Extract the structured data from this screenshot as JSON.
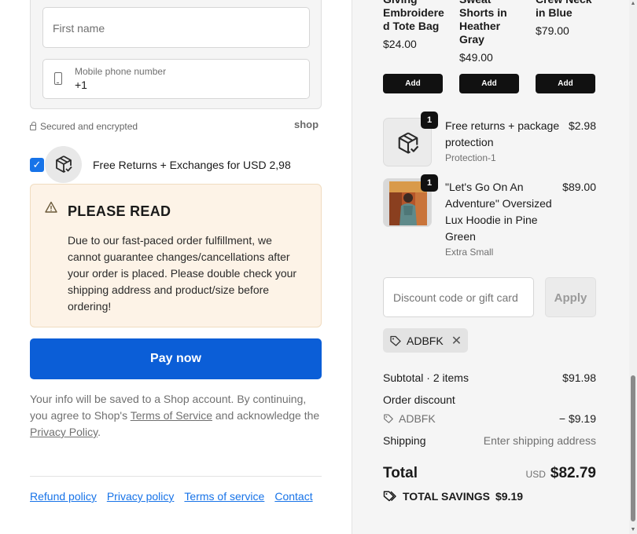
{
  "form": {
    "first_name_placeholder": "First name",
    "phone_label": "Mobile phone number",
    "phone_value": "+1"
  },
  "security": {
    "secure_text": "Secured and encrypted",
    "shop_logo": "shop"
  },
  "protection_option": {
    "checked": true,
    "label": "Free Returns + Exchanges for USD 2,98"
  },
  "notice": {
    "title": "PLEASE READ",
    "body": "Due to our fast-paced order fulfillment, we cannot guarantee changes/cancellations after your order is placed. Please double check your shipping address and product/size before ordering!"
  },
  "pay_button": "Pay now",
  "legal": {
    "prefix": "Your info will be saved to a Shop account. By continuing, you agree to Shop's ",
    "terms_link": "Terms of Service",
    "middle": " and acknowledge the ",
    "privacy_link": "Privacy Policy",
    "suffix": "."
  },
  "footer_links": [
    "Refund policy",
    "Privacy policy",
    "Terms of service",
    "Contact"
  ],
  "upsells": [
    {
      "name": "Giving Embroidere d Tote Bag",
      "price": "$24.00",
      "add_label": "Add"
    },
    {
      "name": "Sweat Shorts in Heather Gray",
      "price": "$49.00",
      "add_label": "Add"
    },
    {
      "name": "Crew Neck in Blue",
      "price": "$79.00",
      "add_label": "Add"
    }
  ],
  "cart_items": [
    {
      "qty": "1",
      "name": "Free returns + package protection",
      "variant": "Protection-1",
      "price": "$2.98",
      "icon": "package-check-icon"
    },
    {
      "qty": "1",
      "name": "\"Let's Go On An Adventure\" Oversized Lux Hoodie in Pine Green",
      "variant": "Extra Small",
      "price": "$89.00",
      "icon": "hoodie-photo"
    }
  ],
  "discount": {
    "placeholder": "Discount code or gift card",
    "apply_label": "Apply",
    "applied_code": "ADBFK"
  },
  "summary": {
    "subtotal_label": "Subtotal · 2 items",
    "subtotal_value": "$91.98",
    "order_discount_label": "Order discount",
    "discount_code": "ADBFK",
    "discount_value": "− $9.19",
    "shipping_label": "Shipping",
    "shipping_value": "Enter shipping address",
    "total_label": "Total",
    "currency": "USD",
    "total_value": "$82.79",
    "savings_label": "TOTAL SAVINGS",
    "savings_value": "$9.19"
  },
  "colors": {
    "accent": "#0b5ed7",
    "link": "#1773e8",
    "notice_bg": "#fdf3e7",
    "summary_bg": "#f5f5f5"
  }
}
